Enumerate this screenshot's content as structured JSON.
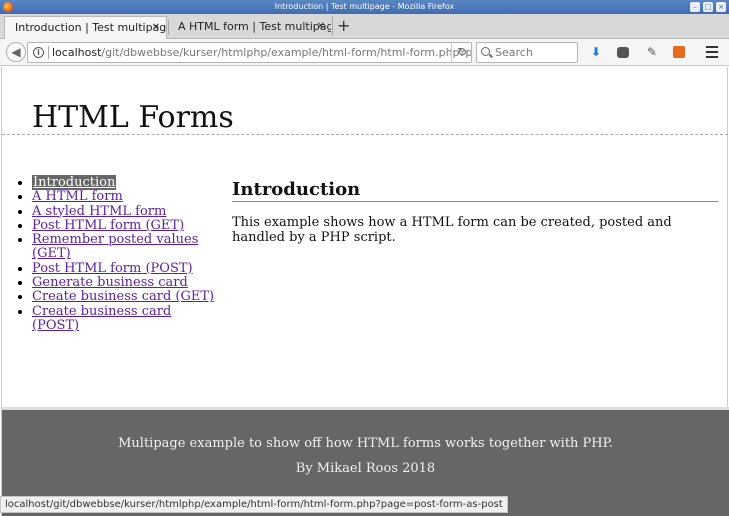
{
  "window": {
    "title": "Introduction | Test multipage - Mozilla Firefox"
  },
  "tabs": [
    {
      "label": "Introduction | Test multipage",
      "active": true
    },
    {
      "label": "A HTML form | Test multipage",
      "active": false
    }
  ],
  "newtab_label": "+",
  "nav": {
    "url_host": "localhost",
    "url_path": "/git/dbwebbse/kurser/htmlphp/example/html-form/html-form.php?pa",
    "search_placeholder": "Search"
  },
  "page": {
    "site_title": "HTML Forms",
    "menu": [
      {
        "label": "Introduction",
        "current": true
      },
      {
        "label": "A HTML form",
        "current": false
      },
      {
        "label": "A styled HTML form",
        "current": false
      },
      {
        "label": "Post HTML form (GET)",
        "current": false
      },
      {
        "label": "Remember posted values (GET)",
        "current": false
      },
      {
        "label": "Post HTML form (POST)",
        "current": false
      },
      {
        "label": "Generate business card",
        "current": false
      },
      {
        "label": "Create business card (GET)",
        "current": false
      },
      {
        "label": "Create business card (POST)",
        "current": false
      }
    ],
    "content_title": "Introduction",
    "content_text": "This example shows how a HTML form can be created, posted and handled by a PHP script.",
    "footer_line1": "Multipage example to show off how HTML forms works together with PHP.",
    "footer_line2": "By Mikael Roos 2018"
  },
  "status_url": "localhost/git/dbwebbse/kurser/htmlphp/example/html-form/html-form.php?page=post-form-as-post",
  "colors": {
    "link": "#5b1fa3",
    "footer_bg": "#666666",
    "titlebar": "#3f6db0"
  }
}
